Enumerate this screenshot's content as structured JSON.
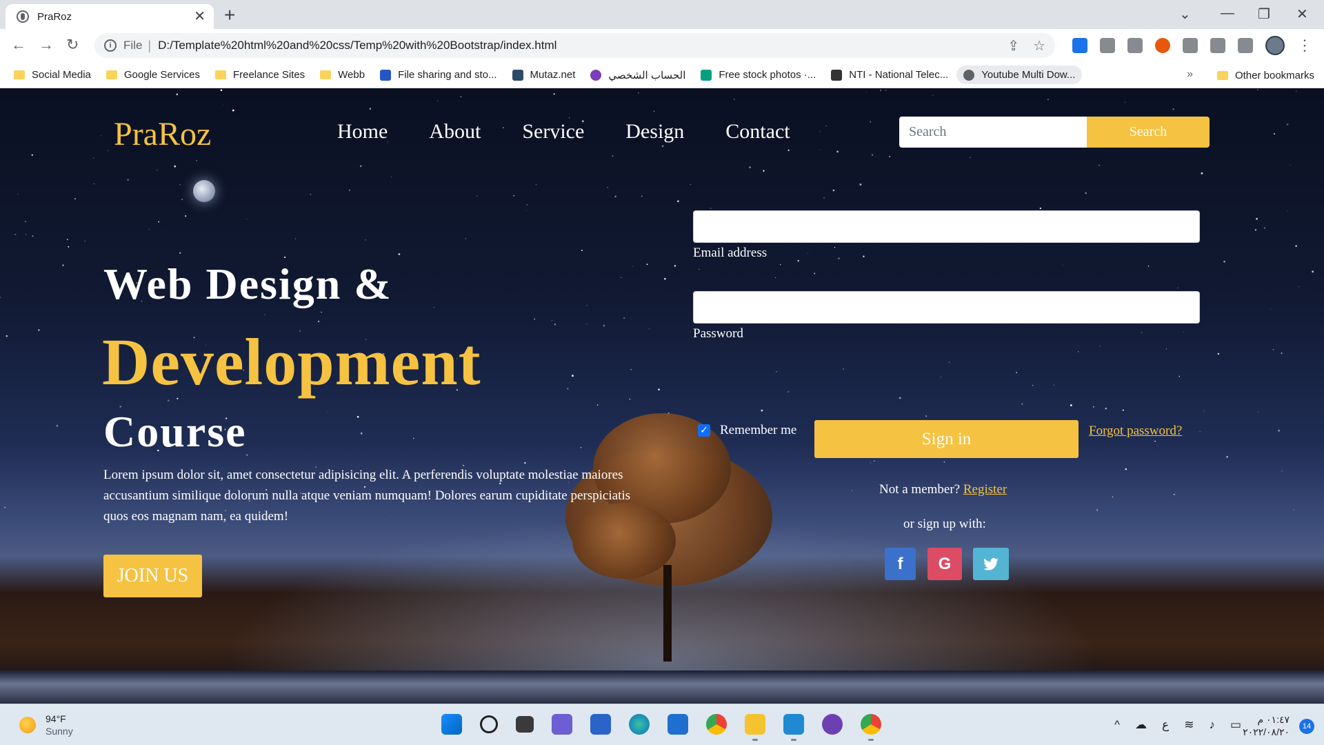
{
  "browser": {
    "tab_title": "PraRoz",
    "url_scheme": "File",
    "url": "D:/Template%20html%20and%20css/Temp%20with%20Bootstrap/index.html",
    "bookmarks": [
      {
        "label": "Social Media",
        "icon": "folder-icon"
      },
      {
        "label": "Google Services",
        "icon": "folder-icon"
      },
      {
        "label": "Freelance Sites",
        "icon": "folder-icon"
      },
      {
        "label": "Webb",
        "icon": "folder-icon"
      },
      {
        "label": "File sharing and sto...",
        "icon": "site-icon"
      },
      {
        "label": "Mutaz.net",
        "icon": "site-icon"
      },
      {
        "label": "الحساب الشخصي",
        "icon": "site-icon"
      },
      {
        "label": "Free stock photos ·...",
        "icon": "site-icon"
      },
      {
        "label": "NTI - National Telec...",
        "icon": "site-icon"
      },
      {
        "label": "Youtube Multi Dow...",
        "icon": "site-icon"
      }
    ],
    "more_bookmarks": "»",
    "other_bookmarks": "Other bookmarks"
  },
  "site": {
    "brand": "PraRoz",
    "nav": [
      "Home",
      "About",
      "Service",
      "Design",
      "Contact"
    ],
    "search_placeholder": "Search",
    "search_button": "Search",
    "hero": {
      "line1": "Web Design &",
      "line2": "Development",
      "line3": "Course",
      "paragraph": "Lorem ipsum dolor sit, amet consectetur adipisicing elit. A perferendis voluptate molestiae maiores accusantium similique dolorum nulla atque veniam numquam! Dolores earum cupiditate perspiciatis quos eos magnam nam, ea quidem!",
      "cta": "JOIN US"
    },
    "form": {
      "email_label": "Email address",
      "password_label": "Password",
      "remember": "Remember me",
      "signin": "Sign in",
      "forgot": "Forgot password?",
      "not_member": "Not a member?",
      "register": "Register",
      "or_sign": "or sign up with:",
      "social": [
        {
          "name": "facebook",
          "glyph": "f",
          "color": "#3b71ca"
        },
        {
          "name": "google",
          "glyph": "G",
          "color": "#dc4c64"
        },
        {
          "name": "twitter",
          "glyph": "t",
          "color": "#54b4d3"
        }
      ]
    },
    "accent": "#f5c242"
  },
  "taskbar": {
    "temp": "94°F",
    "condition": "Sunny",
    "time": "٠١:٤٧ م",
    "date": "٢٠٢٢/٠٨/٢٠",
    "lang": "ع",
    "notifications": "14"
  }
}
